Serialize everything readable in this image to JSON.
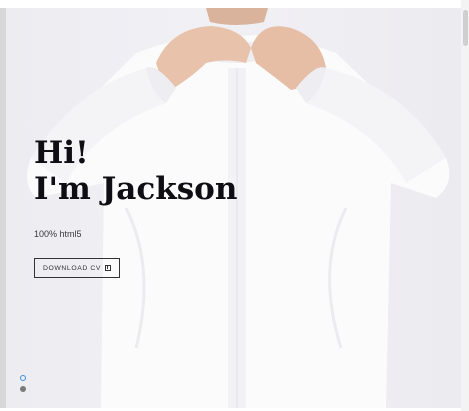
{
  "hero": {
    "greeting": "Hi!",
    "name_line": "I'm Jackson",
    "tagline": "100% html5",
    "cta_label": "DOWNLOAD CV",
    "cta_icon": "download-icon"
  },
  "slider": {
    "dots": [
      {
        "state": "active"
      },
      {
        "state": "inactive"
      }
    ]
  },
  "colors": {
    "background": "#efeef3",
    "text": "#0e0e14",
    "active_dot": "#3d8fd6",
    "inactive_dot": "#7a7a7a"
  }
}
